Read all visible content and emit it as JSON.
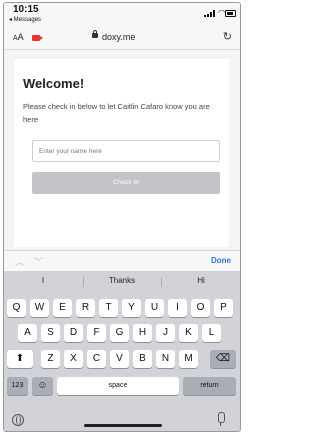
{
  "status_bar": {
    "time": "10:15",
    "back_app": "◂ Messages"
  },
  "url_bar": {
    "aa_label": "AA",
    "url": "doxy.me",
    "reload_icon": "reload-icon"
  },
  "page": {
    "title": "Welcome!",
    "message": "Please check in below to let Caitlin Cafaro know you are here",
    "name_placeholder": "Enter your name here",
    "name_value": "",
    "checkin_label": "Check In"
  },
  "keyboard_toolbar": {
    "done_label": "Done"
  },
  "predictions": [
    "I",
    "Thanks",
    "Hi"
  ],
  "keyboard": {
    "row1": [
      "Q",
      "W",
      "E",
      "R",
      "T",
      "Y",
      "U",
      "I",
      "O",
      "P"
    ],
    "row2": [
      "A",
      "S",
      "D",
      "F",
      "G",
      "H",
      "J",
      "K",
      "L"
    ],
    "row3": [
      "Z",
      "X",
      "C",
      "V",
      "B",
      "N",
      "M"
    ],
    "numbers_label": "123",
    "space_label": "space",
    "return_label": "return"
  },
  "colors": {
    "accent": "#2a7ae2",
    "button_disabled": "#c3c4ca",
    "camera": "#e33333"
  }
}
